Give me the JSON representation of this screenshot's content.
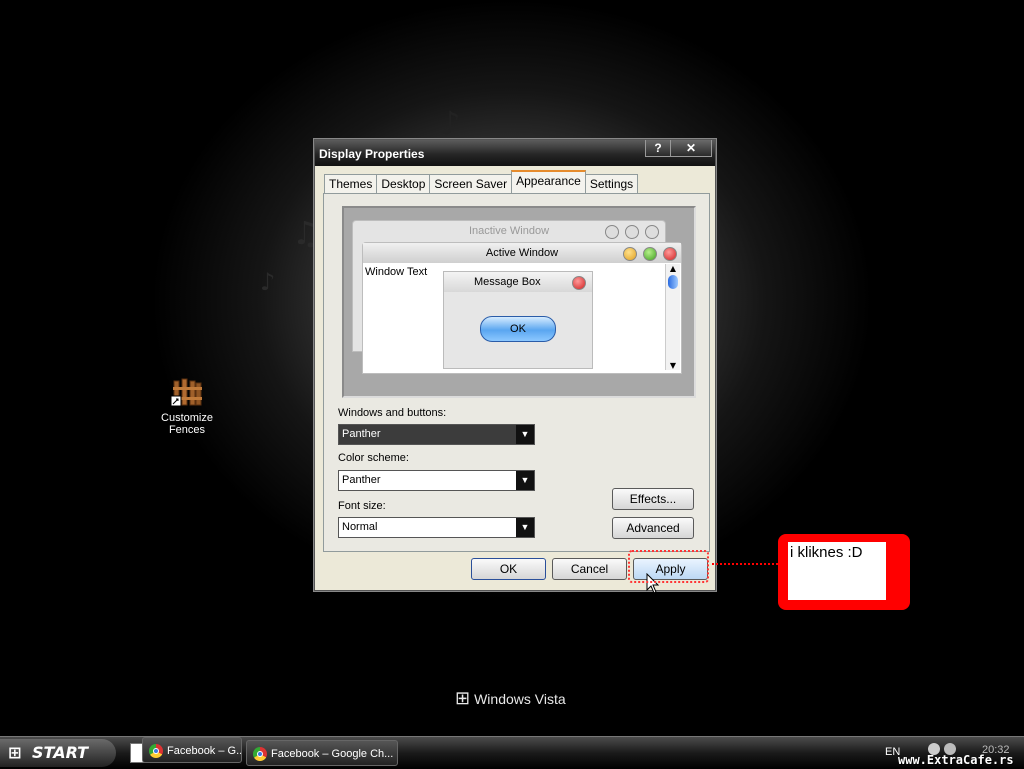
{
  "dialog": {
    "title": "Display Properties",
    "help_label": "?",
    "close_label": "✕",
    "tabs": [
      {
        "label": "Themes"
      },
      {
        "label": "Desktop"
      },
      {
        "label": "Screen Saver"
      },
      {
        "label": "Appearance",
        "active": true
      },
      {
        "label": "Settings"
      }
    ],
    "preview": {
      "inactive_title": "Inactive Window",
      "active_title": "Active Window",
      "window_text": "Window Text",
      "message_title": "Message Box",
      "ok_label": "OK"
    },
    "windows_buttons_label": "Windows and buttons:",
    "windows_buttons_value": "Panther",
    "color_scheme_label": "Color scheme:",
    "color_scheme_value": "Panther",
    "font_size_label": "Font size:",
    "font_size_value": "Normal",
    "effects_label": "Effects...",
    "advanced_label": "Advanced",
    "ok_label": "OK",
    "cancel_label": "Cancel",
    "apply_label": "Apply"
  },
  "desktop": {
    "icon_label_line1": "Customize",
    "icon_label_line2": "Fences",
    "vista_text": "Windows Vista"
  },
  "annotation": {
    "text": "i kliknes  :D"
  },
  "taskbar": {
    "start_label": "START",
    "tasks": [
      {
        "label": "Facebook – G..."
      },
      {
        "label": "Facebook – Google Ch..."
      }
    ],
    "lang": "EN",
    "clock": "20:32",
    "watermark": "www.ExtraCafe.rs"
  },
  "colors": {
    "annotation_red": "#ff0000",
    "tab_highlight": "#e68b2c"
  }
}
